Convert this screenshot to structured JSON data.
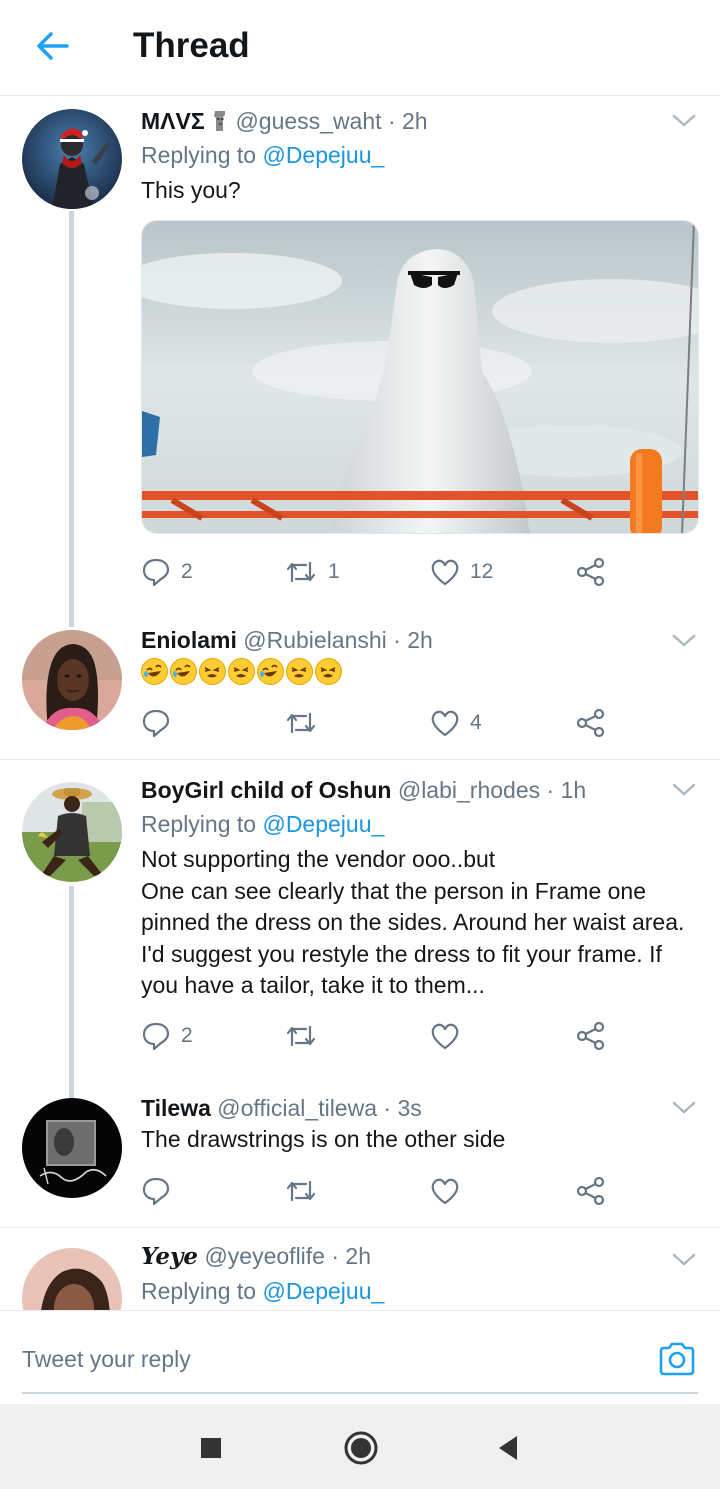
{
  "header": {
    "title": "Thread"
  },
  "colors": {
    "accent": "#1da1f2",
    "link": "#1b95e0",
    "muted": "#657786",
    "text": "#14171a"
  },
  "tweets": [
    {
      "name": "ΜΛVΣ",
      "name_emoji_icon": "moai-icon",
      "handle": "@guess_waht",
      "time": "· 2h",
      "replying_prefix": "Replying to",
      "replying_to": "@Depejuu_",
      "text": "This you?",
      "media": "ghost-in-sheet-with-sunglasses-photo",
      "replies": "2",
      "retweets": "1",
      "likes": "12"
    },
    {
      "name": "Eniolami",
      "handle": "@Rubielanshi",
      "time": "· 2h",
      "emojis": [
        "rofl",
        "rofl",
        "weary",
        "weary",
        "rofl",
        "weary",
        "weary"
      ],
      "replies": "",
      "retweets": "",
      "likes": "4"
    },
    {
      "name": "BoyGirl child of Oshun",
      "handle": "@labi_rhodes",
      "time": "· 1h",
      "replying_prefix": "Replying to",
      "replying_to": "@Depejuu_",
      "text": "Not supporting the vendor ooo..but\nOne can see clearly that the person in Frame one pinned the dress on the sides. Around her waist area. I'd suggest you restyle the dress to fit your frame. If you have a tailor, take it to them...",
      "replies": "2",
      "retweets": "",
      "likes": ""
    },
    {
      "name": "Tilewa",
      "handle": "@official_tilewa",
      "time": "· 3s",
      "text": "The drawstrings is on the other side",
      "replies": "",
      "retweets": "",
      "likes": ""
    },
    {
      "name": "Yeye",
      "handle": "@yeyeoflife",
      "time": "· 2h",
      "replying_prefix": "Replying to",
      "replying_to": "@Depejuu_"
    }
  ],
  "compose": {
    "placeholder": "Tweet your reply"
  },
  "navbar": {
    "items": [
      "recents-square-icon",
      "home-circle-icon",
      "back-triangle-icon"
    ]
  }
}
